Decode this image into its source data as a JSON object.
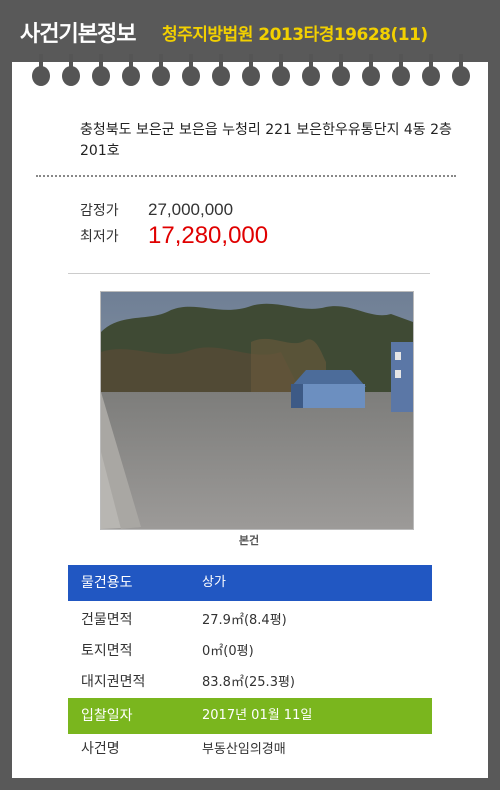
{
  "header": {
    "title": "사건기본정보",
    "case": "청주지방법원 2013타경19628(11)"
  },
  "address": "충청북도 보은군 보은읍 누청리 221 보은한우유통단지 4동 2층 201호",
  "prices": {
    "appraised_label": "감정가",
    "appraised_value": "27,000,000",
    "minimum_label": "최저가",
    "minimum_value": "17,280,000"
  },
  "photo": {
    "caption": "본건"
  },
  "details": {
    "usage_label": "물건용도",
    "usage_value": "상가",
    "building_area_label": "건물면적",
    "building_area_value": "27.9㎡(8.4평)",
    "land_area_label": "토지면적",
    "land_area_value": "0㎡(0평)",
    "site_right_area_label": "대지권면적",
    "site_right_area_value": "83.8㎡(25.3평)",
    "bid_date_label": "입찰일자",
    "bid_date_value": "2017년 01월 11일",
    "case_name_label": "사건명",
    "case_name_value": "부동산임의경매"
  },
  "colors": {
    "header_bg": "#595959",
    "case_text": "#f2d000",
    "min_price": "#e00000",
    "usage_row": "#2157c2",
    "bid_row": "#7ab61e"
  }
}
